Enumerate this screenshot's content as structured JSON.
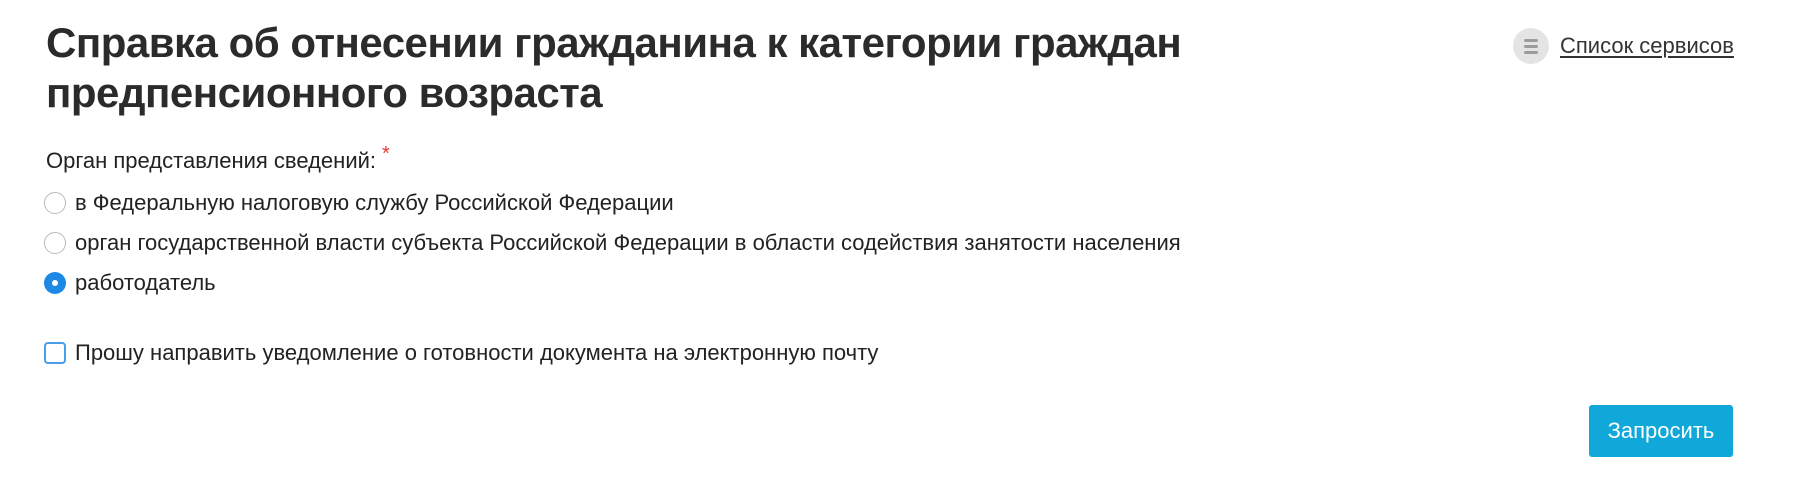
{
  "page": {
    "title": "Справка об отнесении гражданина к категории граждан предпенсионного возраста"
  },
  "header": {
    "services_link": "Список сервисов",
    "services_icon": "list-icon"
  },
  "form": {
    "organ_label": "Орган представления сведений:",
    "required_mark": "*",
    "options": [
      {
        "label": "в Федеральную налоговую службу Российской Федерации",
        "checked": false
      },
      {
        "label": "орган государственной власти субъекта Российской Федерации в области содействия занятости населения",
        "checked": false
      },
      {
        "label": "работодатель",
        "checked": true
      }
    ],
    "email_notify_label": "Прошу направить уведомление о готовности документа на электронную почту",
    "email_notify_checked": false,
    "submit_label": "Запросить"
  },
  "colors": {
    "accent_button": "#0fa8d8",
    "radio_selected": "#1e88e5",
    "required": "#e53935"
  }
}
